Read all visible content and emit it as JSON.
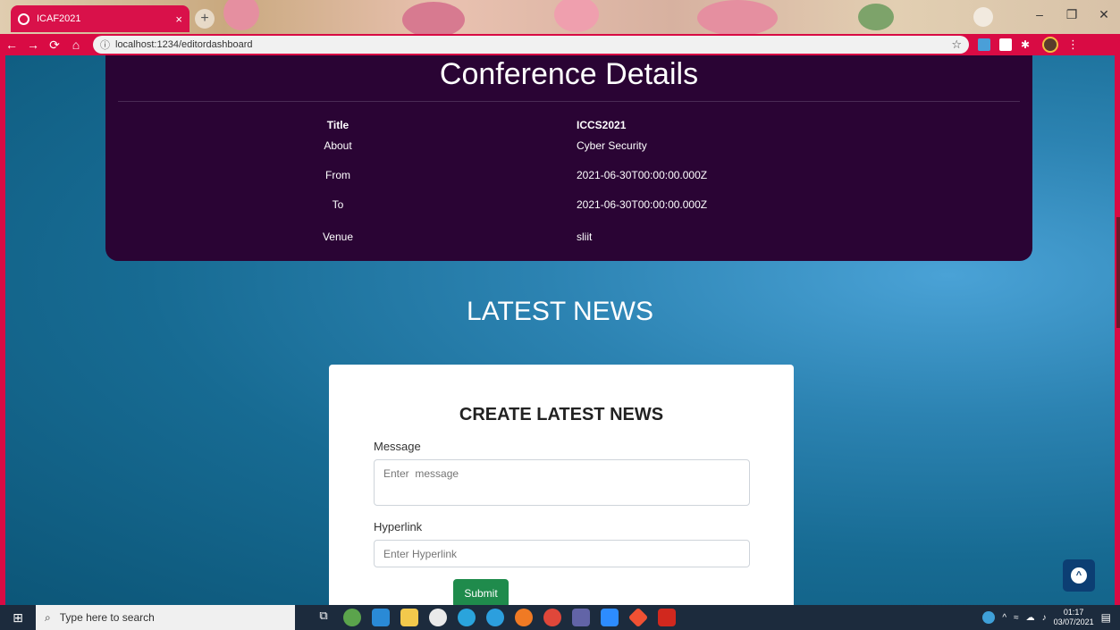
{
  "browser": {
    "tab_title": "ICAF2021",
    "tab_close": "×",
    "new_tab": "+",
    "url": "localhost:1234/editordashboard",
    "window_controls": [
      "–",
      "❐",
      "✕"
    ]
  },
  "conference": {
    "heading": "Conference Details",
    "rows": [
      {
        "label": "Title",
        "value": "ICCS2021"
      },
      {
        "label": "About",
        "value": "Cyber Security"
      },
      {
        "label": "From",
        "value": "2021-06-30T00:00:00.000Z"
      },
      {
        "label": "To",
        "value": "2021-06-30T00:00:00.000Z"
      },
      {
        "label": "Venue",
        "value": "sliit"
      }
    ]
  },
  "news": {
    "heading": "LATEST NEWS",
    "form_title": "CREATE LATEST NEWS",
    "message_label": "Message",
    "message_placeholder": "Enter  message",
    "hyperlink_label": "Hyperlink",
    "hyperlink_placeholder": "Enter Hyperlink",
    "submit_label": "Submit"
  },
  "taskbar": {
    "search_placeholder": "Type here to search",
    "time": "01:17",
    "date": "03/07/2021"
  },
  "colors": {
    "browser_accent": "#d90b44",
    "card_bg": "#2a0434",
    "submit_green": "#1f8b4c",
    "scroll_top_btn": "#0c3e73"
  }
}
